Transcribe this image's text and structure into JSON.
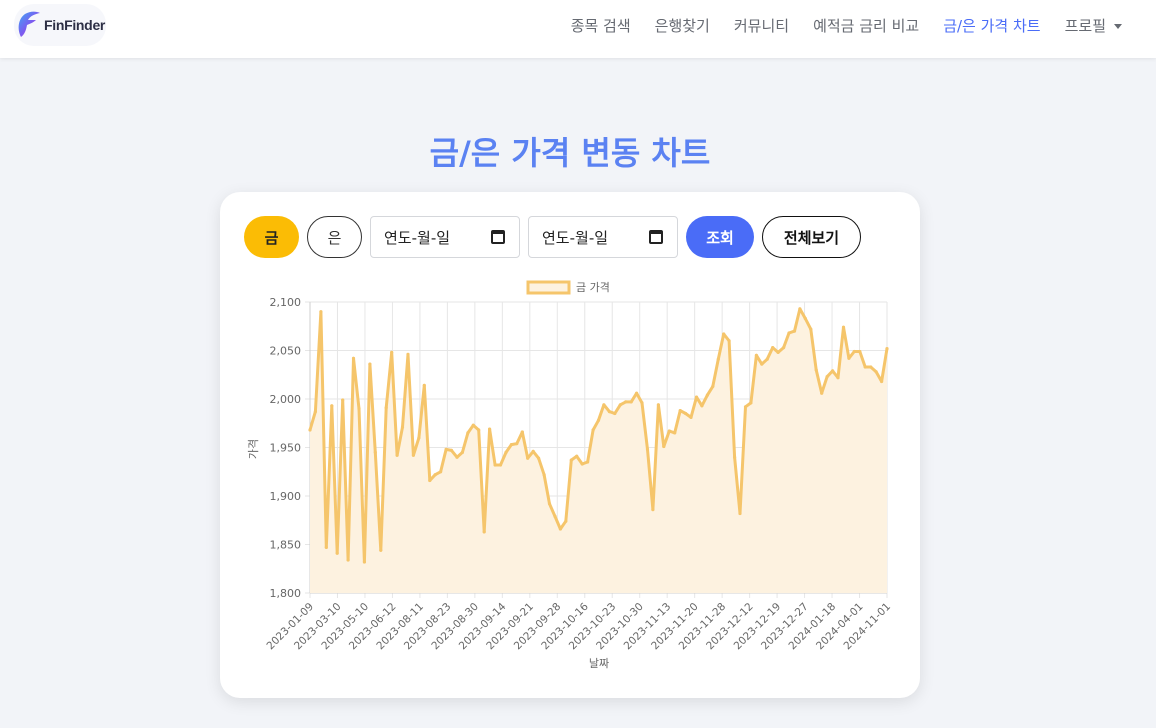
{
  "navbar": {
    "logo_text": "FinFinder",
    "links": [
      {
        "label": "종목 검색",
        "active": false
      },
      {
        "label": "은행찾기",
        "active": false
      },
      {
        "label": "커뮤니티",
        "active": false
      },
      {
        "label": "예적금 금리 비교",
        "active": false
      },
      {
        "label": "금/은 가격 차트",
        "active": true
      }
    ],
    "profile_label": "프로필"
  },
  "page": {
    "title": "금/은 가격 변동 차트"
  },
  "controls": {
    "gold_label": "금",
    "silver_label": "은",
    "start_date_placeholder": "연도-월-일",
    "end_date_placeholder": "연도-월-일",
    "query_label": "조회",
    "all_label": "전체보기"
  },
  "colors": {
    "accent": "#4a6cf7",
    "title": "#5b82f2",
    "gold_button": "#fbbc05",
    "line": "#f5c56b",
    "fill": "#fdf2e0"
  },
  "chart_data": {
    "type": "area",
    "legend": "금 가격",
    "legend_position": "top",
    "xlabel": "날짜",
    "ylabel": "가격",
    "ylim": [
      1800,
      2100
    ],
    "y_ticks": [
      1800,
      1850,
      1900,
      1950,
      2000,
      2050,
      2100
    ],
    "y_tick_labels": [
      "1,800",
      "1,850",
      "1,900",
      "1,950",
      "2,000",
      "2,050",
      "2,100"
    ],
    "grid": true,
    "x_tick_labels": [
      "2023-01-09",
      "2023-03-10",
      "2023-05-10",
      "2023-06-12",
      "2023-08-11",
      "2023-08-23",
      "2023-08-30",
      "2023-09-14",
      "2023-09-21",
      "2023-09-28",
      "2023-10-16",
      "2023-10-23",
      "2023-10-30",
      "2023-11-13",
      "2023-11-20",
      "2023-11-28",
      "2023-12-12",
      "2023-12-19",
      "2023-12-27",
      "2024-01-18",
      "2024-04-01",
      "2024-11-01"
    ],
    "series": [
      {
        "name": "금 가격",
        "values": [
          1968,
          1987,
          2090,
          1847,
          1993,
          1841,
          1999,
          1834,
          2042,
          1990,
          1832,
          2036,
          1945,
          1844,
          1991,
          2048,
          1942,
          1971,
          2046,
          1942,
          1960,
          2014,
          1916,
          1922,
          1925,
          1948,
          1947,
          1940,
          1945,
          1965,
          1973,
          1968,
          1863,
          1969,
          1932,
          1932,
          1945,
          1953,
          1954,
          1966,
          1939,
          1946,
          1939,
          1922,
          1892,
          1879,
          1866,
          1874,
          1937,
          1941,
          1933,
          1935,
          1968,
          1978,
          1994,
          1987,
          1985,
          1994,
          1997,
          1997,
          2006,
          1996,
          1948,
          1886,
          1994,
          1951,
          1967,
          1965,
          1988,
          1985,
          1981,
          2002,
          1993,
          2004,
          2013,
          2041,
          2067,
          2060,
          1940,
          1882,
          1992,
          1996,
          2045,
          2036,
          2041,
          2053,
          2048,
          2053,
          2068,
          2070,
          2093,
          2083,
          2072,
          2030,
          2006,
          2023,
          2029,
          2022,
          2074,
          2042,
          2049,
          2049,
          2033,
          2033,
          2028,
          2018,
          2052
        ]
      }
    ]
  }
}
